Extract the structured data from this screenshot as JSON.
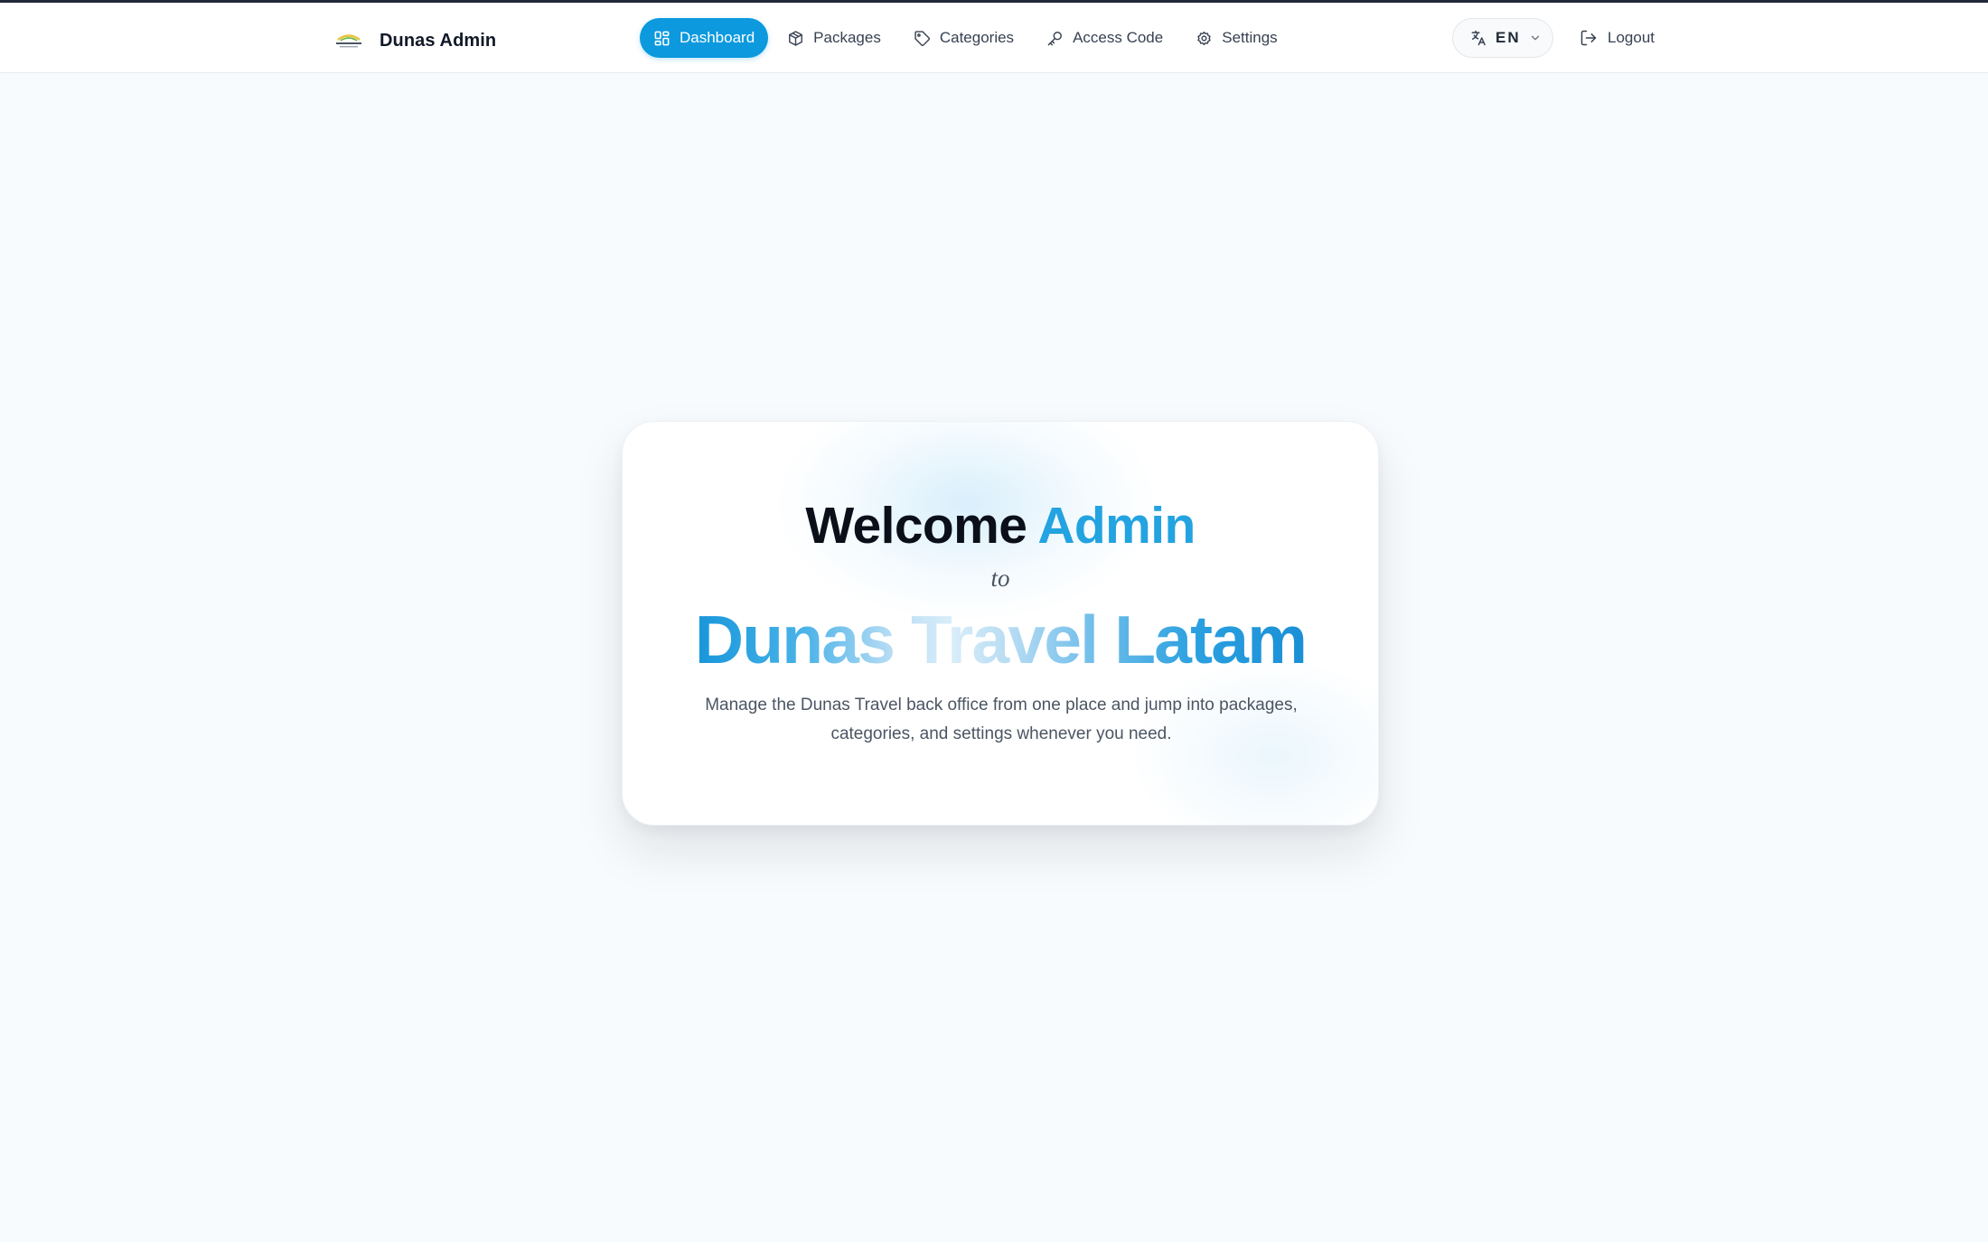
{
  "brand": {
    "name": "Dunas Admin",
    "logo_icon": "dunas-logo-icon"
  },
  "nav": {
    "items": [
      {
        "label": "Dashboard",
        "icon": "layout-grid-icon",
        "active": true
      },
      {
        "label": "Packages",
        "icon": "package-icon",
        "active": false
      },
      {
        "label": "Categories",
        "icon": "tag-icon",
        "active": false
      },
      {
        "label": "Access Code",
        "icon": "key-icon",
        "active": false
      },
      {
        "label": "Settings",
        "icon": "gear-icon",
        "active": false
      }
    ]
  },
  "language": {
    "code": "EN",
    "icon": "translate-icon"
  },
  "logout": {
    "label": "Logout",
    "icon": "logout-icon"
  },
  "hero": {
    "welcome": "Welcome",
    "user": "Admin",
    "connector": "to",
    "company": "Dunas Travel Latam",
    "description": "Manage the Dunas Travel back office from one place and jump into packages, categories, and settings whenever you need."
  },
  "colors": {
    "accent": "#0c99de",
    "accent_text": "#23a3e0",
    "background": "#f8fbfd"
  }
}
